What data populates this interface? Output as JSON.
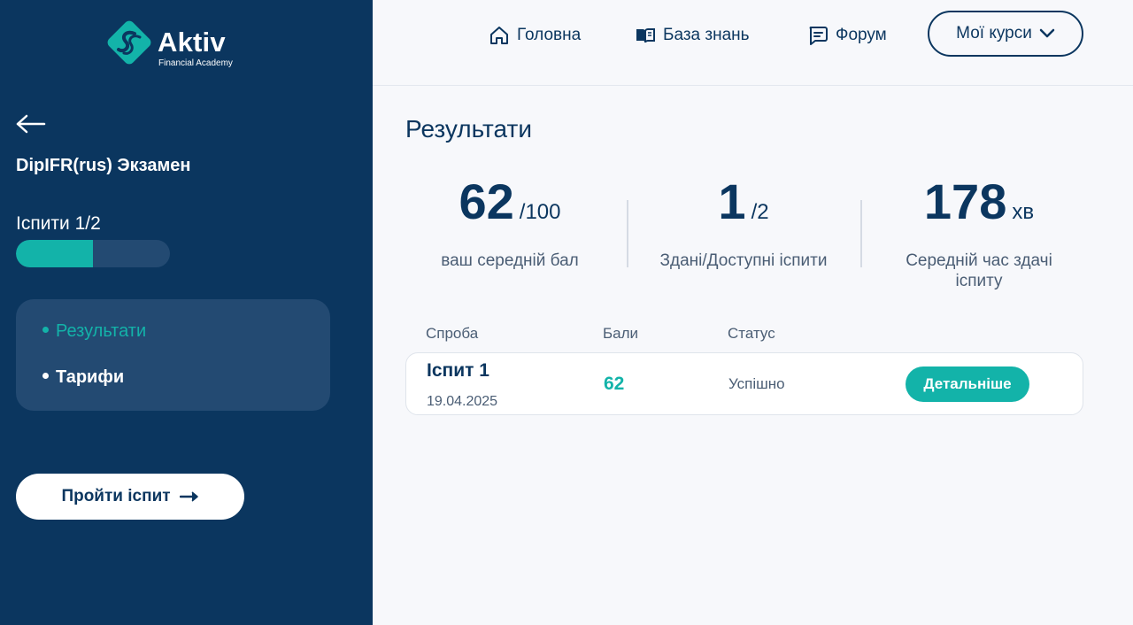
{
  "brand": {
    "name": "Aktiv",
    "subtitle": "Financial Academy",
    "accent": "#13b3a9",
    "navy": "#0b365f"
  },
  "sidebar": {
    "back_icon": "arrow-left-icon",
    "course_title": "DipIFR(rus) Экзамен",
    "exams_progress_label": "Іспити 1/2",
    "exams_progress": {
      "done": 1,
      "total": 2,
      "fraction": 0.5
    },
    "menu": [
      {
        "label": "Результати",
        "active": true
      },
      {
        "label": "Тарифи",
        "active": false
      }
    ],
    "take_exam_label": "Пройти іспит"
  },
  "nav": {
    "home": {
      "label": "Головна",
      "icon": "home-icon"
    },
    "knowledge_base": {
      "label": "База знань",
      "icon": "book-icon"
    },
    "forum": {
      "label": "Форум",
      "icon": "chat-icon"
    },
    "my_courses": {
      "label": "Мої курси",
      "icon": "chevron-down-icon"
    }
  },
  "results": {
    "title": "Результати",
    "stats": [
      {
        "value": "62",
        "suffix": "/100",
        "label": "ваш середній бал"
      },
      {
        "value": "1",
        "suffix": "/2",
        "label": "Здані/Доступні іспити"
      },
      {
        "value": "178",
        "suffix": "хв",
        "label": "Середній час здачі іспиту"
      }
    ],
    "table": {
      "headers": [
        "Спроба",
        "Бали",
        "Статус"
      ],
      "rows": [
        {
          "name": "Іспит 1",
          "date": "19.04.2025",
          "score": "62",
          "status": "Успішно",
          "action": "Детальніше"
        }
      ]
    }
  }
}
